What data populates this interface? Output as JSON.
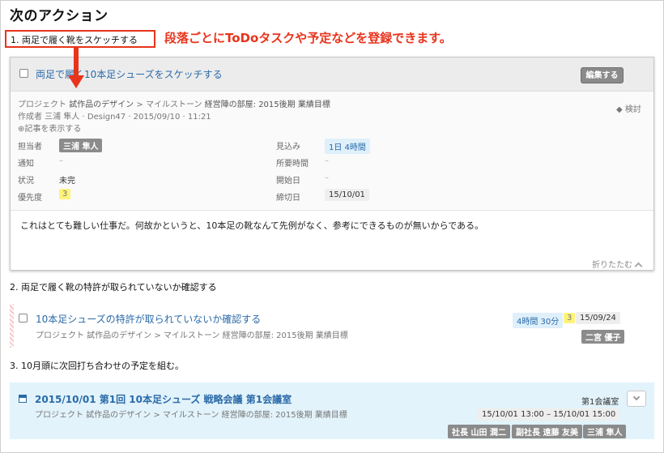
{
  "section_title": "次のアクション",
  "annotation": {
    "callout": "段落ごとにToDoタスクや予定などを登録できます。"
  },
  "steps": [
    {
      "label": "1. 両足で履く靴をスケッチする"
    },
    {
      "label": "2. 両足で履く靴の特許が取られていないか確認する"
    },
    {
      "label": "3. 10月頭に次回打ち合わせの予定を組む。"
    }
  ],
  "task1": {
    "title": "両足で履く10本足シューズをスケッチする",
    "edit_label": "編集する",
    "breadcrumb": {
      "project_label": "プロジェクト",
      "project": "試作品のデザイン",
      "sep": ">",
      "milestone_label": "マイルストーン",
      "milestone": "経営陣の部屋: 2015後期 業績目標"
    },
    "author_line": "作成者 三浦 隼人 · Design47 · 2015/09/10 · 11:21",
    "show_record": "記事を表示する",
    "tag": "検討",
    "fields_left": [
      {
        "label": "担当者",
        "value": "三浦 隼人",
        "style": "gray"
      },
      {
        "label": "通知",
        "value": "–",
        "style": "dash"
      },
      {
        "label": "状況",
        "value": "未完",
        "style": "plain"
      },
      {
        "label": "優先度",
        "value": "3",
        "style": "yellow"
      }
    ],
    "fields_right": [
      {
        "label": "見込み",
        "value": "1日 4時間",
        "style": "blue"
      },
      {
        "label": "所要時間",
        "value": "–",
        "style": "dash"
      },
      {
        "label": "開始日",
        "value": "–",
        "style": "dash"
      },
      {
        "label": "締切日",
        "value": "15/10/01",
        "style": "boxed"
      }
    ],
    "description": "これはとても難しい仕事だ。何故かというと、10本足の靴なんて先例がなく、参考にできるものが無いからである。",
    "collapse_label": "折りたたむ"
  },
  "task2": {
    "title": "10本足シューズの特許が取られていないか確認する",
    "breadcrumb": "プロジェクト 試作品のデザイン > マイルストーン 経営陣の部屋: 2015後期 業績目標",
    "estimate": "4時間 30分",
    "priority": "3",
    "due": "15/09/24",
    "assignee": "二宮 優子"
  },
  "event": {
    "title": "2015/10/01 第1回 10本足シューズ 戦略会議 第1会議室",
    "breadcrumb": "プロジェクト 試作品のデザイン > マイルストーン 経営陣の部屋: 2015後期 業績目標",
    "location": "第1会議室",
    "time_range": "15/10/01 13:00 – 15/10/01 15:00",
    "attendees": [
      "社長 山田 潤二",
      "副社長 遠藤 友美",
      "三浦 隼人"
    ]
  },
  "colors": {
    "accent_red": "#e8341c",
    "link_blue": "#2a6aa8",
    "event_bg": "#e2f3fb",
    "tag_gray": "#8b8b8b",
    "priority_yellow": "#fff27a"
  }
}
